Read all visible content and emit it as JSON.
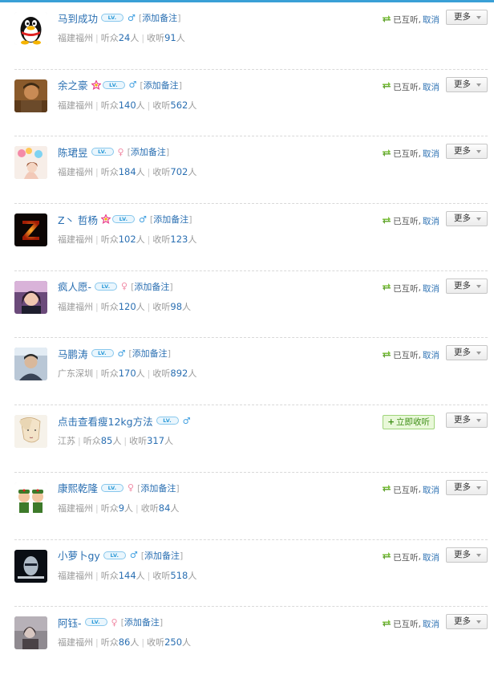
{
  "colors": {
    "link": "#2a6fb2",
    "accent_bar": "#3aa0d6",
    "follow_green": "#3d8e16"
  },
  "labels": {
    "add_remark": "添加备注",
    "mutual": "已互听",
    "cancel": "取消",
    "follow_now": "立即收听",
    "more": "更多",
    "listeners_prefix": "听众",
    "following_prefix": "收听",
    "unit": "人"
  },
  "users": [
    {
      "name": "马到成功",
      "star": false,
      "gender": "male",
      "remark": true,
      "location": "福建福州",
      "listeners": "24",
      "following": "91",
      "state": "mutual",
      "avatar": "penguin-avatar"
    },
    {
      "name": "余之豪",
      "star": true,
      "gender": "male",
      "remark": true,
      "location": "福建福州",
      "listeners": "140",
      "following": "562",
      "state": "mutual",
      "avatar": "soldier-avatar"
    },
    {
      "name": "陈珺昱",
      "star": false,
      "gender": "female",
      "remark": true,
      "location": "福建福州",
      "listeners": "184",
      "following": "702",
      "state": "mutual",
      "avatar": "balloon-girl-avatar"
    },
    {
      "name": "Z丶 哲杨",
      "star": true,
      "gender": "male",
      "remark": true,
      "location": "福建福州",
      "listeners": "102",
      "following": "123",
      "state": "mutual",
      "avatar": "fire-z-avatar"
    },
    {
      "name": "疯人愿-",
      "star": false,
      "gender": "female",
      "remark": true,
      "location": "福建福州",
      "listeners": "120",
      "following": "98",
      "state": "mutual",
      "avatar": "girl-photo-avatar"
    },
    {
      "name": "马鹏涛",
      "star": false,
      "gender": "male",
      "remark": true,
      "location": "广东深圳",
      "listeners": "170",
      "following": "892",
      "state": "mutual",
      "avatar": "man-photo-avatar"
    },
    {
      "name": "点击查看瘦12kg方法",
      "star": false,
      "gender": "male",
      "remark": false,
      "location": "江苏",
      "listeners": "85",
      "following": "317",
      "state": "follow",
      "avatar": "sketch-avatar"
    },
    {
      "name": "康熙乾隆",
      "star": false,
      "gender": "female",
      "remark": true,
      "location": "福建福州",
      "listeners": "9",
      "following": "84",
      "state": "mutual",
      "avatar": "cartoon-soldiers-avatar"
    },
    {
      "name": "小萝卜gy",
      "star": false,
      "gender": "male",
      "remark": true,
      "location": "福建福州",
      "listeners": "144",
      "following": "518",
      "state": "mutual",
      "avatar": "dark-portrait-avatar"
    },
    {
      "name": "阿钰-",
      "star": false,
      "gender": "female",
      "remark": true,
      "location": "福建福州",
      "listeners": "86",
      "following": "250",
      "state": "mutual",
      "avatar": "grey-photo-avatar"
    }
  ]
}
